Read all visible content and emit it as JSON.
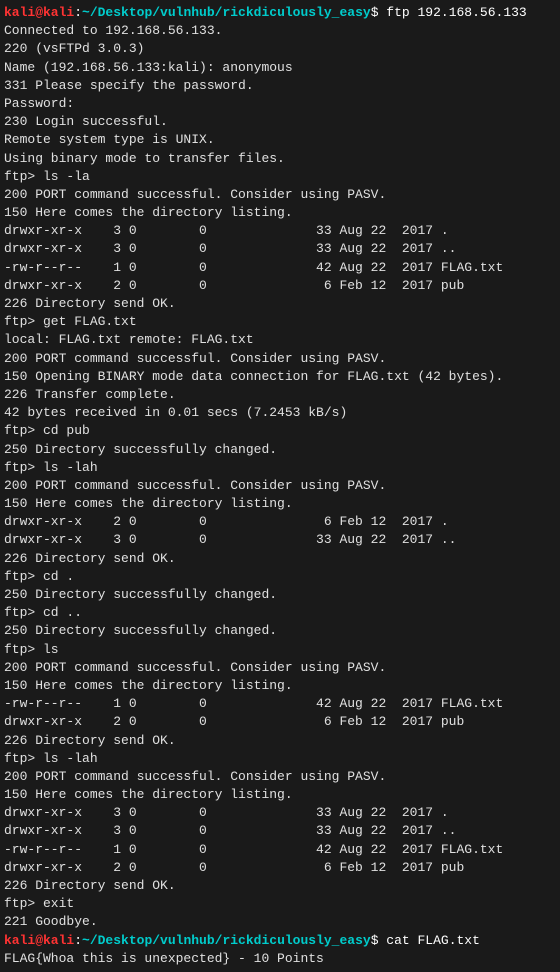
{
  "prompt1": {
    "user": "kali@kali",
    "colon": ":",
    "path": "~/Desktop/vulnhub/rickdiculously_easy",
    "dollar": "$ ",
    "cmd": "ftp 192.168.56.133"
  },
  "lines": [
    "Connected to 192.168.56.133.",
    "220 (vsFTPd 3.0.3)",
    "Name (192.168.56.133:kali): anonymous",
    "331 Please specify the password.",
    "Password:",
    "230 Login successful.",
    "Remote system type is UNIX.",
    "Using binary mode to transfer files.",
    "ftp> ls -la",
    "200 PORT command successful. Consider using PASV.",
    "150 Here comes the directory listing.",
    "drwxr-xr-x    3 0        0              33 Aug 22  2017 .",
    "drwxr-xr-x    3 0        0              33 Aug 22  2017 ..",
    "-rw-r--r--    1 0        0              42 Aug 22  2017 FLAG.txt",
    "drwxr-xr-x    2 0        0               6 Feb 12  2017 pub",
    "226 Directory send OK.",
    "ftp> get FLAG.txt",
    "local: FLAG.txt remote: FLAG.txt",
    "200 PORT command successful. Consider using PASV.",
    "150 Opening BINARY mode data connection for FLAG.txt (42 bytes).",
    "226 Transfer complete.",
    "42 bytes received in 0.01 secs (7.2453 kB/s)",
    "ftp> cd pub",
    "250 Directory successfully changed.",
    "ftp> ls -lah",
    "200 PORT command successful. Consider using PASV.",
    "150 Here comes the directory listing.",
    "drwxr-xr-x    2 0        0               6 Feb 12  2017 .",
    "drwxr-xr-x    3 0        0              33 Aug 22  2017 ..",
    "226 Directory send OK.",
    "ftp> cd .",
    "250 Directory successfully changed.",
    "ftp> cd ..",
    "250 Directory successfully changed.",
    "ftp> ls",
    "200 PORT command successful. Consider using PASV.",
    "150 Here comes the directory listing.",
    "-rw-r--r--    1 0        0              42 Aug 22  2017 FLAG.txt",
    "drwxr-xr-x    2 0        0               6 Feb 12  2017 pub",
    "226 Directory send OK.",
    "ftp> ls -lah",
    "200 PORT command successful. Consider using PASV.",
    "150 Here comes the directory listing.",
    "drwxr-xr-x    3 0        0              33 Aug 22  2017 .",
    "drwxr-xr-x    3 0        0              33 Aug 22  2017 ..",
    "-rw-r--r--    1 0        0              42 Aug 22  2017 FLAG.txt",
    "drwxr-xr-x    2 0        0               6 Feb 12  2017 pub",
    "226 Directory send OK.",
    "ftp> exit",
    "221 Goodbye."
  ],
  "prompt2": {
    "user": "kali@kali",
    "colon": ":",
    "path": "~/Desktop/vulnhub/rickdiculously_easy",
    "dollar": "$ ",
    "cmd": "cat FLAG.txt"
  },
  "flag": "FLAG{Whoa this is unexpected} - 10 Points"
}
